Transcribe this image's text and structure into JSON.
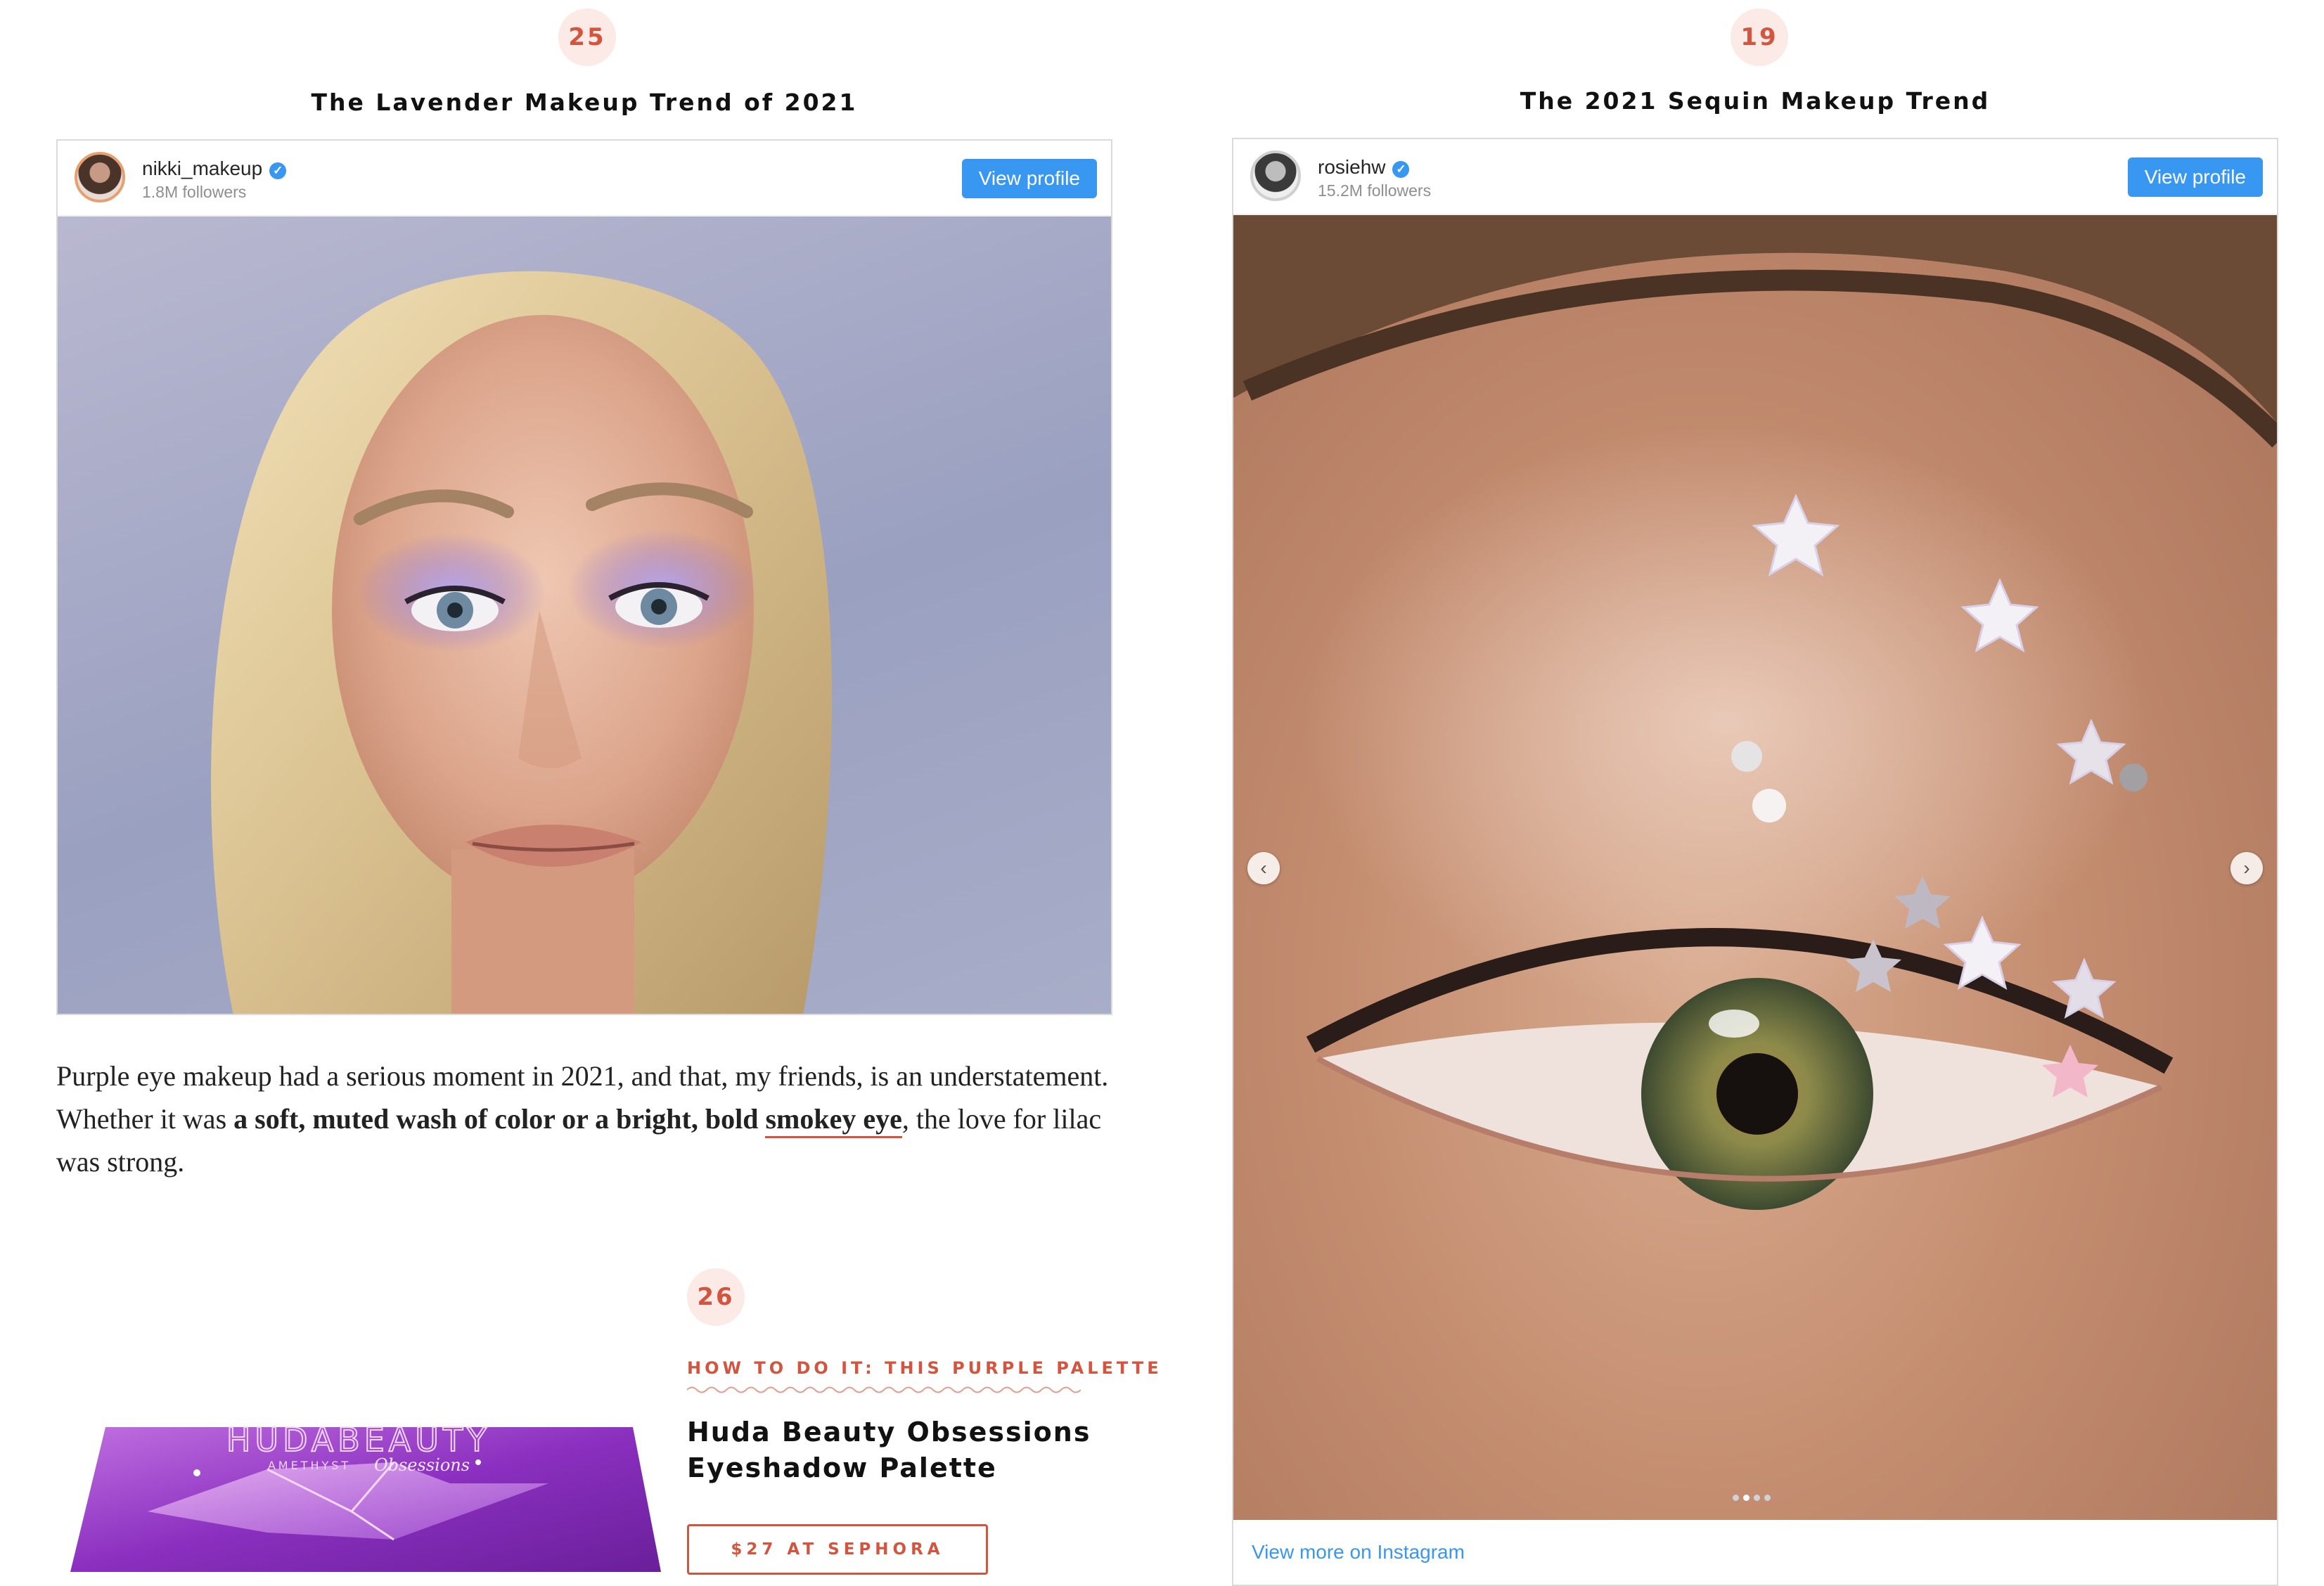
{
  "left_item": {
    "number": "25",
    "title": "The Lavender Makeup Trend of 2021",
    "instagram": {
      "username": "nikki_makeup",
      "followers": "1.8M followers",
      "view_profile": "View profile",
      "verified_mark": "✓"
    }
  },
  "right_item": {
    "number": "19",
    "title": "The 2021 Sequin Makeup Trend",
    "instagram": {
      "username": "rosiehw",
      "followers": "15.2M followers",
      "view_profile": "View profile",
      "verified_mark": "✓",
      "prev_arrow": "‹",
      "next_arrow": "›",
      "view_more": "View more on Instagram",
      "carousel_dots": 4,
      "carousel_active": 2
    }
  },
  "article": {
    "p1_a": "Purple eye makeup had a serious moment in 2021, and that, my friends, is an understatement. Whether it was ",
    "p1_bold": "a soft, muted wash of color or a bright, bold ",
    "p1_link": "smokey eye",
    "p1_end": ", the love for lilac was strong."
  },
  "product": {
    "number": "26",
    "kicker": "HOW TO DO IT: THIS PURPLE PALETTE",
    "name": "Huda Beauty Obsessions Eyeshadow Palette",
    "button": "$27 AT SEPHORA",
    "box_brand": "HUDABEAUTY",
    "box_line": "AMETHYST",
    "box_script": "Obsessions"
  },
  "colors": {
    "accent": "#d4553f",
    "badge_bg": "#fbeae6",
    "instagram_blue": "#3897f0"
  }
}
